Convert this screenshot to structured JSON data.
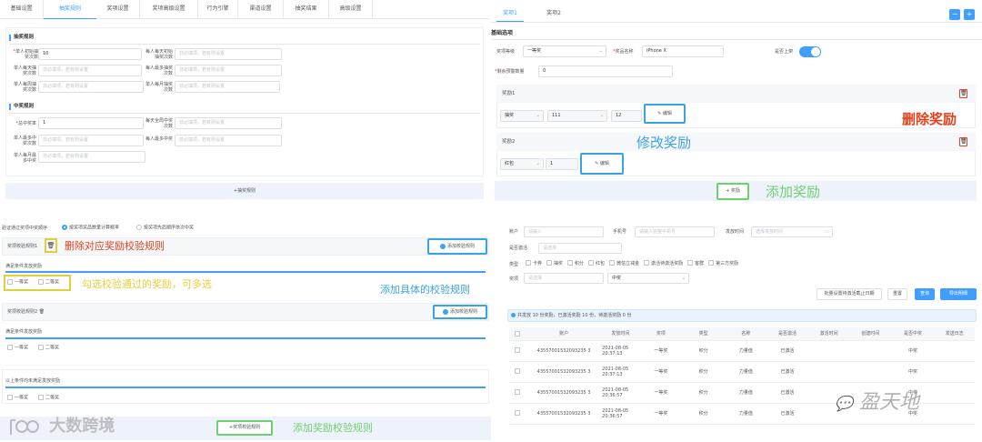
{
  "left_top": {
    "tabs": [
      "基础设置",
      "抽奖规则",
      "奖项设置",
      "奖项高级设置",
      "行为引擎",
      "渠道设置",
      "抽奖结果",
      "高级设置"
    ],
    "active_tab": 1,
    "section1": "抽奖规则",
    "f1_label": "单人初始抽奖次数",
    "f1_value": "10",
    "f2_label": "每人每天初始抽奖次数",
    "f2_placeholder": "非必填项，若有则设置",
    "f3_label": "单人每天抽奖次数",
    "f3_placeholder": "非必填项，若有则设置",
    "f4_label": "每人最多抽奖次数",
    "f4_placeholder": "非必填项，若有则设置",
    "f5_label": "单人每周抽奖次数",
    "f5_placeholder": "非必填项，若有则设置",
    "f6_label": "单人每月抽奖次数",
    "f6_placeholder": "非必填项，若有则设置",
    "section2": "中奖规则",
    "g1_label": "总中奖率",
    "g1_value": "1",
    "g2_label": "每天全局中奖次数",
    "g2_placeholder": "非必填项，若有则设置",
    "g3_label": "单人最多中奖次数",
    "g3_placeholder": "非必填项，若有则设置",
    "g4_label": "每人最多中奖",
    "g4_placeholder": "非必填项，若有则设置",
    "g5_label": "单人每月最多中奖",
    "g5_placeholder": "非必填项，若有则设置",
    "add_rule_btn": "+抽奖规则"
  },
  "right_top": {
    "tabs": [
      "奖项1",
      "奖项2"
    ],
    "minus": "−",
    "plus": "+",
    "section": "基础选项",
    "level_label": "奖项等级",
    "level_value": "一等奖",
    "name_label": "奖品名称",
    "name_value": "iPhone X",
    "online_label": "是否上架",
    "stock_label": "剩余预警数量",
    "stock_value": "0",
    "reward1_title": "奖励1",
    "r1_type": "抽奖",
    "r1_val": "111",
    "r1_count": "12",
    "edit": "编辑",
    "reward2_title": "奖励2",
    "r2_type": "红包",
    "r2_count": "1",
    "add_reward_btn": "+ 奖励",
    "ann_delete": "删除奖励",
    "ann_edit": "修改奖励",
    "ann_add": "添加奖励"
  },
  "left_bottom": {
    "order_label": "验证通过奖项中奖顺序",
    "opt1": "按奖项奖品数量计算概率",
    "opt2": "按奖项先后顺序依次中奖",
    "rule1_title": "奖项校验规则1",
    "ann_delete": "删除对应奖励校验规则",
    "add_check_btn": "添加校验规则",
    "cond1": "满足条件发放奖励",
    "c_first": "一等奖",
    "c_second": "二等奖",
    "ann_check": "勾选校验通过的奖励，可多选",
    "ann_add_check": "添加具体的校验规则",
    "rule2_title": "奖项校验规则2",
    "cond2": "满足条件发放奖励",
    "cond3": "以上条件均未满足发放奖励",
    "add_reward_rule_btn": "+奖项校验规则",
    "ann_add_reward_rule": "添加奖励校验规则",
    "watermark": "大数跨境"
  },
  "right_bottom": {
    "account_label": "账户",
    "account_ph": "请输入",
    "phone_label": "手机号",
    "phone_ph": "请输入完整手机号",
    "time_label": "发放时间",
    "time_ph": "选择发放时间",
    "active_label": "是否激活",
    "active_ph": "请选择",
    "type_label": "类型",
    "types": [
      "卡券",
      "抽奖",
      "积分",
      "红包",
      "微信立减金",
      "激活待激活奖励",
      "客群",
      "第三方奖励"
    ],
    "prize_label": "奖项",
    "prize_ph": "请选择",
    "prize_value": "中奖",
    "btn_batch": "批量设置待激活截止日期",
    "btn_reset": "重置",
    "btn_query": "查询",
    "btn_export": "导出明细",
    "info": "共发放 10 份奖励，已激活奖励 10 份，待激活奖励 0 份",
    "headers": [
      "账户",
      "发放时间",
      "奖项",
      "类型",
      "名称",
      "是否激活",
      "激活时间",
      "创建时间",
      "是否中奖",
      "发送日志"
    ],
    "rows": [
      [
        "43557001532093235 3",
        "2021-08-05 20:37:13",
        "一等奖",
        "积分",
        "力量值",
        "已激活",
        "",
        "",
        "中奖",
        ""
      ],
      [
        "43557001532093235 3",
        "2021-08-05 20:37:13",
        "一等奖",
        "积分",
        "力量值",
        "已激活",
        "",
        "",
        "中奖",
        ""
      ],
      [
        "43557001532093235 3",
        "2021-08-05 20:36:57",
        "一等奖",
        "积分",
        "力量值",
        "已激活",
        "",
        "",
        "中奖",
        ""
      ],
      [
        "43557001532093235 3",
        "2021-08-05 20:36:57",
        "一等奖",
        "积分",
        "力量值",
        "已激活",
        "",
        "",
        "中奖",
        ""
      ]
    ],
    "watermark": "盈天地"
  },
  "colors": {
    "accent": "#409eff",
    "red": "#e8401c",
    "blue_ann": "#3aa3e3",
    "green_ann": "#6ed06e",
    "yellow_ann": "#e3cf3a"
  }
}
